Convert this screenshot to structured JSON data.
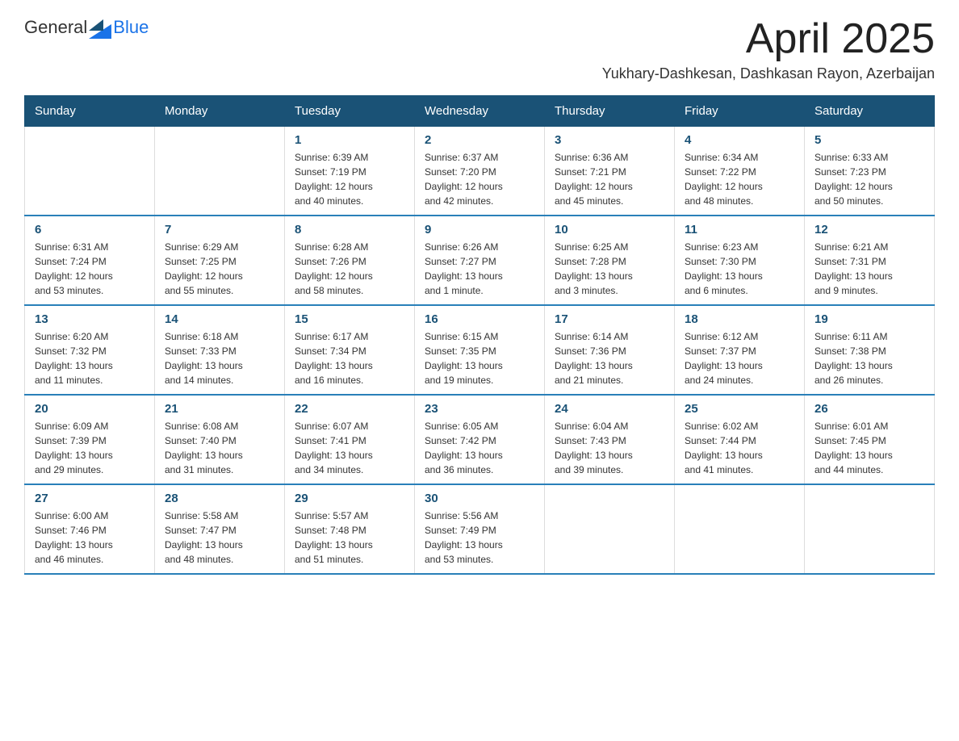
{
  "logo": {
    "text_general": "General",
    "text_blue": "Blue",
    "aria": "GeneralBlue logo"
  },
  "header": {
    "title": "April 2025",
    "subtitle": "Yukhary-Dashkesan, Dashkasan Rayon, Azerbaijan"
  },
  "days_of_week": [
    "Sunday",
    "Monday",
    "Tuesday",
    "Wednesday",
    "Thursday",
    "Friday",
    "Saturday"
  ],
  "weeks": [
    [
      {
        "day": "",
        "info": ""
      },
      {
        "day": "",
        "info": ""
      },
      {
        "day": "1",
        "info": "Sunrise: 6:39 AM\nSunset: 7:19 PM\nDaylight: 12 hours\nand 40 minutes."
      },
      {
        "day": "2",
        "info": "Sunrise: 6:37 AM\nSunset: 7:20 PM\nDaylight: 12 hours\nand 42 minutes."
      },
      {
        "day": "3",
        "info": "Sunrise: 6:36 AM\nSunset: 7:21 PM\nDaylight: 12 hours\nand 45 minutes."
      },
      {
        "day": "4",
        "info": "Sunrise: 6:34 AM\nSunset: 7:22 PM\nDaylight: 12 hours\nand 48 minutes."
      },
      {
        "day": "5",
        "info": "Sunrise: 6:33 AM\nSunset: 7:23 PM\nDaylight: 12 hours\nand 50 minutes."
      }
    ],
    [
      {
        "day": "6",
        "info": "Sunrise: 6:31 AM\nSunset: 7:24 PM\nDaylight: 12 hours\nand 53 minutes."
      },
      {
        "day": "7",
        "info": "Sunrise: 6:29 AM\nSunset: 7:25 PM\nDaylight: 12 hours\nand 55 minutes."
      },
      {
        "day": "8",
        "info": "Sunrise: 6:28 AM\nSunset: 7:26 PM\nDaylight: 12 hours\nand 58 minutes."
      },
      {
        "day": "9",
        "info": "Sunrise: 6:26 AM\nSunset: 7:27 PM\nDaylight: 13 hours\nand 1 minute."
      },
      {
        "day": "10",
        "info": "Sunrise: 6:25 AM\nSunset: 7:28 PM\nDaylight: 13 hours\nand 3 minutes."
      },
      {
        "day": "11",
        "info": "Sunrise: 6:23 AM\nSunset: 7:30 PM\nDaylight: 13 hours\nand 6 minutes."
      },
      {
        "day": "12",
        "info": "Sunrise: 6:21 AM\nSunset: 7:31 PM\nDaylight: 13 hours\nand 9 minutes."
      }
    ],
    [
      {
        "day": "13",
        "info": "Sunrise: 6:20 AM\nSunset: 7:32 PM\nDaylight: 13 hours\nand 11 minutes."
      },
      {
        "day": "14",
        "info": "Sunrise: 6:18 AM\nSunset: 7:33 PM\nDaylight: 13 hours\nand 14 minutes."
      },
      {
        "day": "15",
        "info": "Sunrise: 6:17 AM\nSunset: 7:34 PM\nDaylight: 13 hours\nand 16 minutes."
      },
      {
        "day": "16",
        "info": "Sunrise: 6:15 AM\nSunset: 7:35 PM\nDaylight: 13 hours\nand 19 minutes."
      },
      {
        "day": "17",
        "info": "Sunrise: 6:14 AM\nSunset: 7:36 PM\nDaylight: 13 hours\nand 21 minutes."
      },
      {
        "day": "18",
        "info": "Sunrise: 6:12 AM\nSunset: 7:37 PM\nDaylight: 13 hours\nand 24 minutes."
      },
      {
        "day": "19",
        "info": "Sunrise: 6:11 AM\nSunset: 7:38 PM\nDaylight: 13 hours\nand 26 minutes."
      }
    ],
    [
      {
        "day": "20",
        "info": "Sunrise: 6:09 AM\nSunset: 7:39 PM\nDaylight: 13 hours\nand 29 minutes."
      },
      {
        "day": "21",
        "info": "Sunrise: 6:08 AM\nSunset: 7:40 PM\nDaylight: 13 hours\nand 31 minutes."
      },
      {
        "day": "22",
        "info": "Sunrise: 6:07 AM\nSunset: 7:41 PM\nDaylight: 13 hours\nand 34 minutes."
      },
      {
        "day": "23",
        "info": "Sunrise: 6:05 AM\nSunset: 7:42 PM\nDaylight: 13 hours\nand 36 minutes."
      },
      {
        "day": "24",
        "info": "Sunrise: 6:04 AM\nSunset: 7:43 PM\nDaylight: 13 hours\nand 39 minutes."
      },
      {
        "day": "25",
        "info": "Sunrise: 6:02 AM\nSunset: 7:44 PM\nDaylight: 13 hours\nand 41 minutes."
      },
      {
        "day": "26",
        "info": "Sunrise: 6:01 AM\nSunset: 7:45 PM\nDaylight: 13 hours\nand 44 minutes."
      }
    ],
    [
      {
        "day": "27",
        "info": "Sunrise: 6:00 AM\nSunset: 7:46 PM\nDaylight: 13 hours\nand 46 minutes."
      },
      {
        "day": "28",
        "info": "Sunrise: 5:58 AM\nSunset: 7:47 PM\nDaylight: 13 hours\nand 48 minutes."
      },
      {
        "day": "29",
        "info": "Sunrise: 5:57 AM\nSunset: 7:48 PM\nDaylight: 13 hours\nand 51 minutes."
      },
      {
        "day": "30",
        "info": "Sunrise: 5:56 AM\nSunset: 7:49 PM\nDaylight: 13 hours\nand 53 minutes."
      },
      {
        "day": "",
        "info": ""
      },
      {
        "day": "",
        "info": ""
      },
      {
        "day": "",
        "info": ""
      }
    ]
  ]
}
